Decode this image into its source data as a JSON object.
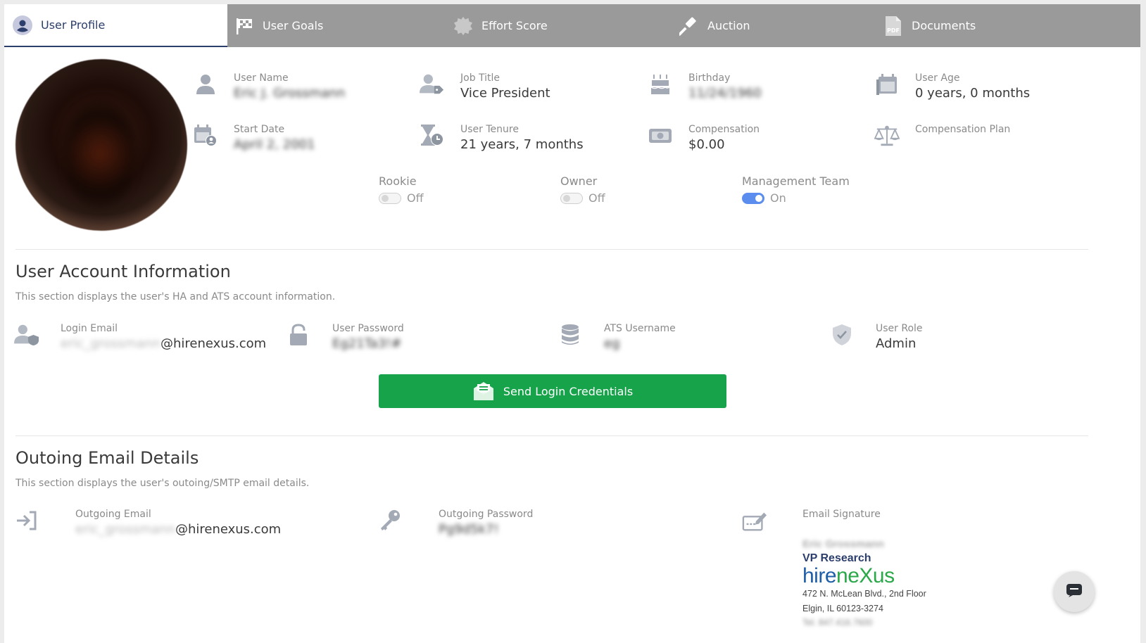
{
  "tabs": [
    {
      "label": "User Profile",
      "icon": "user-circle-icon",
      "active": true
    },
    {
      "label": "User Goals",
      "icon": "flag-icon",
      "active": false
    },
    {
      "label": "Effort Score",
      "icon": "badge-icon",
      "active": false
    },
    {
      "label": "Auction",
      "icon": "gavel-icon",
      "active": false
    },
    {
      "label": "Documents",
      "icon": "pdf-file-icon",
      "active": false
    }
  ],
  "profile": {
    "user_name": {
      "label": "User Name",
      "value": "Eric J. Grossmann"
    },
    "job_title": {
      "label": "Job Title",
      "value": "Vice President"
    },
    "birthday": {
      "label": "Birthday",
      "value": "11/24/1960"
    },
    "user_age": {
      "label": "User Age",
      "value": "0 years, 0 months"
    },
    "start_date": {
      "label": "Start Date",
      "value": "April 2, 2001"
    },
    "user_tenure": {
      "label": "User Tenure",
      "value": "21 years, 7 months"
    },
    "compensation": {
      "label": "Compensation",
      "value": "$0.00"
    },
    "compensation_plan": {
      "label": "Compensation Plan",
      "value": ""
    }
  },
  "toggles": {
    "rookie": {
      "label": "Rookie",
      "state": "Off",
      "on": false
    },
    "owner": {
      "label": "Owner",
      "state": "Off",
      "on": false
    },
    "management": {
      "label": "Management Team",
      "state": "On",
      "on": true
    }
  },
  "account": {
    "title": "User Account Information",
    "description": "This section displays the user's HA and ATS account information.",
    "login_email": {
      "label": "Login Email",
      "value_prefix": "eric_grossmann",
      "value_suffix": "@hirenexus.com"
    },
    "password": {
      "label": "User Password",
      "value": "Eg21Ta3!#"
    },
    "ats_username": {
      "label": "ATS Username",
      "value": "eg"
    },
    "user_role": {
      "label": "User Role",
      "value": "Admin"
    },
    "send_button": "Send Login Credentials"
  },
  "outgoing": {
    "title": "Outoing Email Details",
    "description": "This section displays the user's outoing/SMTP email details.",
    "email": {
      "label": "Outgoing Email",
      "value_prefix": "eric_grossmann",
      "value_suffix": "@hirenexus.com"
    },
    "password": {
      "label": "Outgoing Password",
      "value": "Pg9d5k7!"
    },
    "signature": {
      "label": "Email Signature",
      "name": "Eric Grossmann",
      "title": "VP Research",
      "logo_part1": "hire",
      "logo_part2": "neXus",
      "address1": "472 N. McLean Blvd., 2nd Floor",
      "address2": "Elgin, IL 60123-3274",
      "tel": "Tel. 847.416.7600"
    }
  },
  "colors": {
    "tab_bar": "#9a9a9a",
    "active_tab_text": "#2c3e6b",
    "send_button": "#16a34a",
    "toggle_on": "#5b8def"
  }
}
